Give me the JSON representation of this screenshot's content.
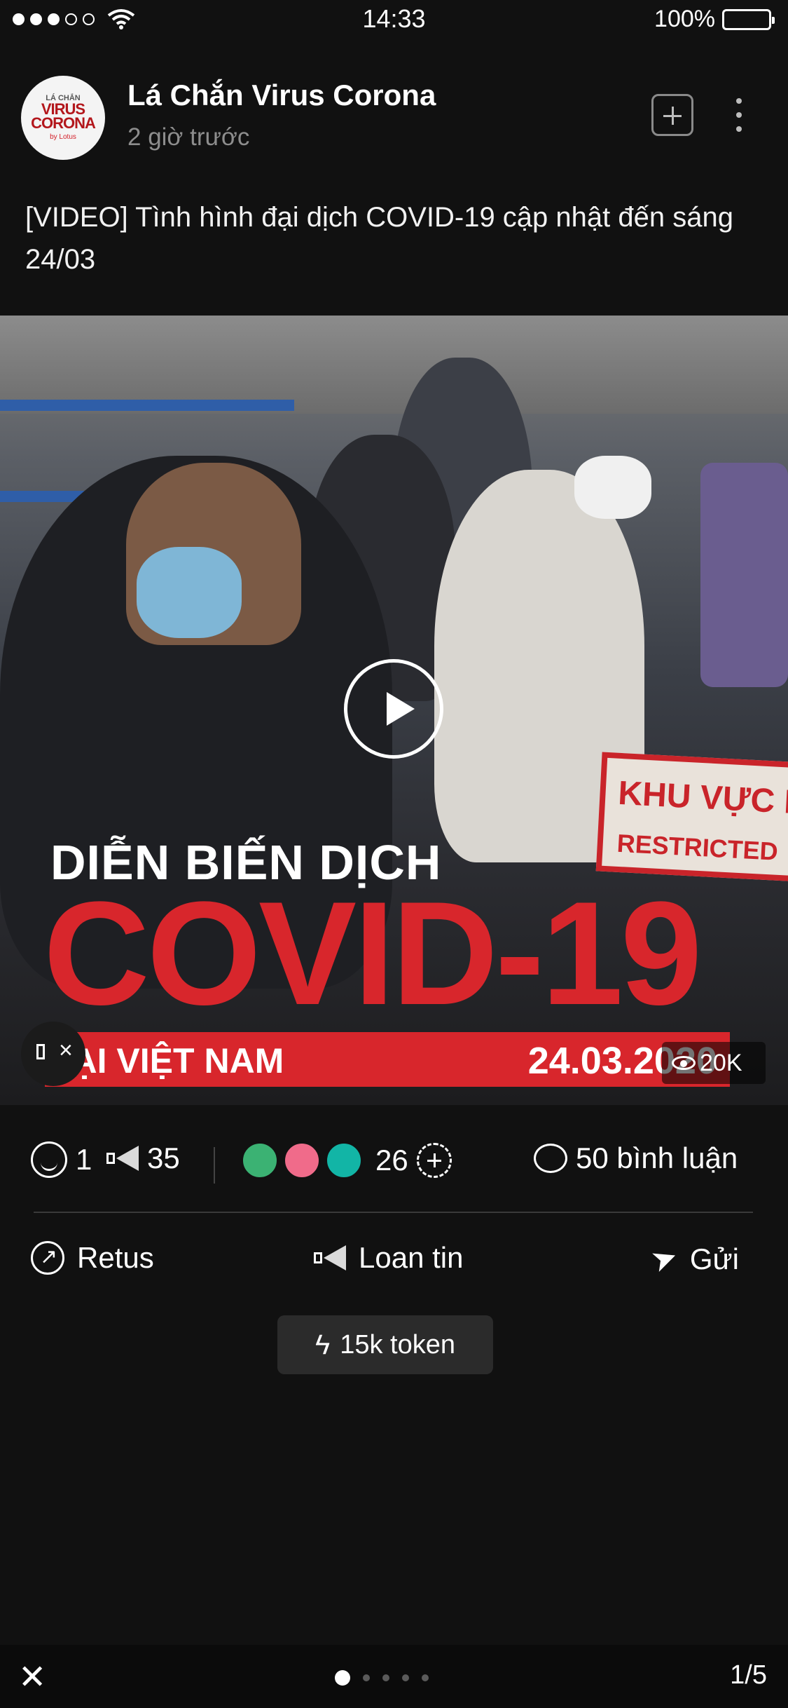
{
  "status": {
    "time": "14:33",
    "battery": "100%",
    "signal_dots_filled": 3,
    "signal_dots_total": 5
  },
  "post": {
    "author": "Lá Chắn Virus Corona",
    "avatar_text": {
      "top": "LÁ CHẮN",
      "main": "VIRUS CORONA",
      "by": "by Lotus"
    },
    "time_ago": "2 giờ trước",
    "caption": "[VIDEO] Tình hình đại dịch COVID-19 cập nhật đến sáng 24/03"
  },
  "media": {
    "headline": "DIỄN BIẾN DỊCH",
    "big_title": "COVID-19",
    "ribbon_left": "TẠI VIỆT NAM",
    "ribbon_right": "24.03.2020",
    "sign_line1": "KHU VỰC HẠ",
    "sign_line2": "RESTRICTED",
    "views": "20K"
  },
  "stats": {
    "reactions": "1",
    "shares": "35",
    "emoji_count": "26",
    "comments": "50 bình luận",
    "emoji_colors": [
      "#3bb273",
      "#f06b8a",
      "#12b5a6"
    ]
  },
  "actions": {
    "retus": "Retus",
    "loan_tin": "Loan tin",
    "gui": "Gửi"
  },
  "token": {
    "label": "15k token"
  },
  "bottom": {
    "page_indicator": "1/5",
    "page_count": 5,
    "active_page": 1
  },
  "colors": {
    "accent_red": "#d8262c",
    "background": "#111111"
  }
}
